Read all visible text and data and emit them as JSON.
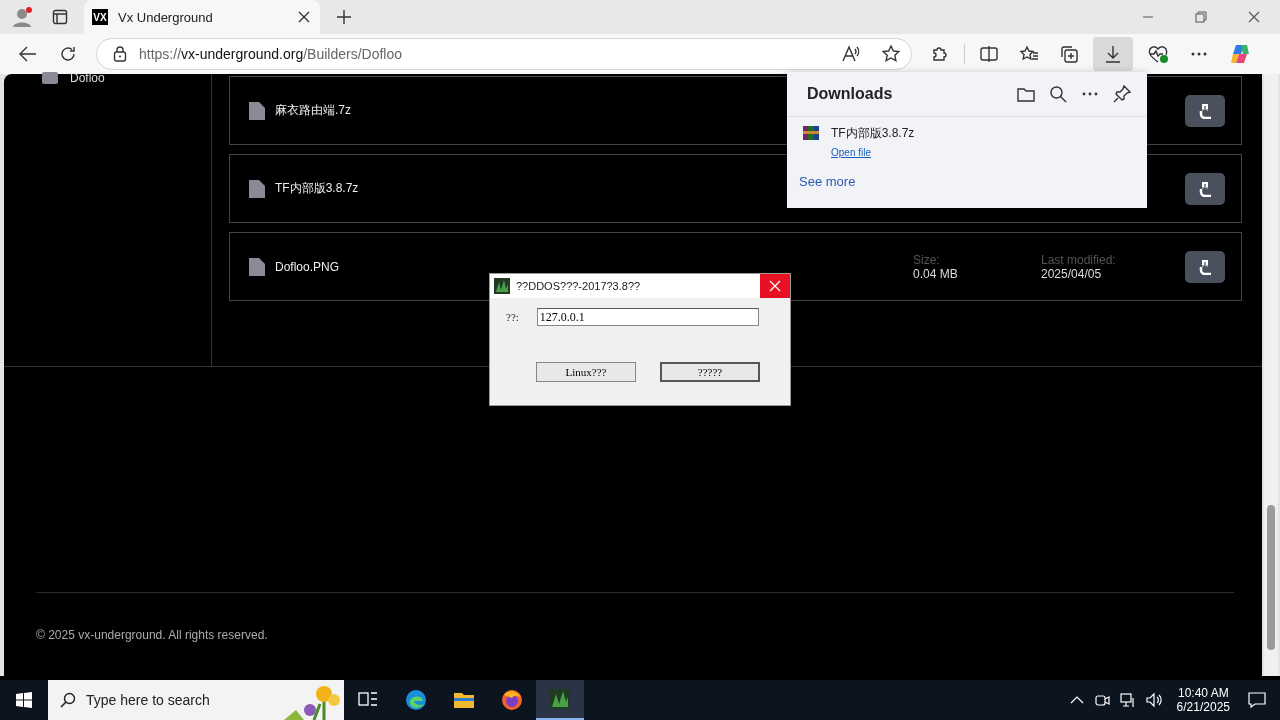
{
  "browser": {
    "tabs": [
      {
        "title": "Vx Underground",
        "favicon": "VX",
        "selected": true
      }
    ],
    "address": {
      "scheme": "https://",
      "host": "vx-underground.org",
      "path": "/Builders/Dofloo"
    }
  },
  "sidebar": {
    "items": [
      {
        "label": "Dofloo"
      }
    ]
  },
  "files": [
    {
      "name": "麻衣路由端.7z"
    },
    {
      "name": "TF内部版3.8.7z"
    },
    {
      "name": "Dofloo.PNG",
      "size_label": "Size:",
      "size": "0.04 MB",
      "modified_label": "Last modified:",
      "modified": "2025/04/05"
    }
  ],
  "footer": {
    "copyright": "© 2025 vx-underground. All rights reserved."
  },
  "downloads": {
    "title": "Downloads",
    "items": [
      {
        "name": "TF内部版3.8.7z",
        "action": "Open file"
      }
    ],
    "see_more": "See more"
  },
  "dialog": {
    "title": "??DDOS???-2017?3.8??",
    "field_label": "??:",
    "field_value": "127.0.0.1",
    "buttons": [
      {
        "label": "Linux???",
        "default": false
      },
      {
        "label": "?????",
        "default": true
      }
    ]
  },
  "taskbar": {
    "search_placeholder": "Type here to search",
    "apps": [
      {
        "kind": "taskview",
        "active": false
      },
      {
        "kind": "edge",
        "active": false
      },
      {
        "kind": "explorer",
        "active": false
      },
      {
        "kind": "firefox",
        "active": false
      },
      {
        "kind": "app",
        "active": true
      }
    ],
    "time": "10:40 AM",
    "date": "6/21/2025"
  }
}
